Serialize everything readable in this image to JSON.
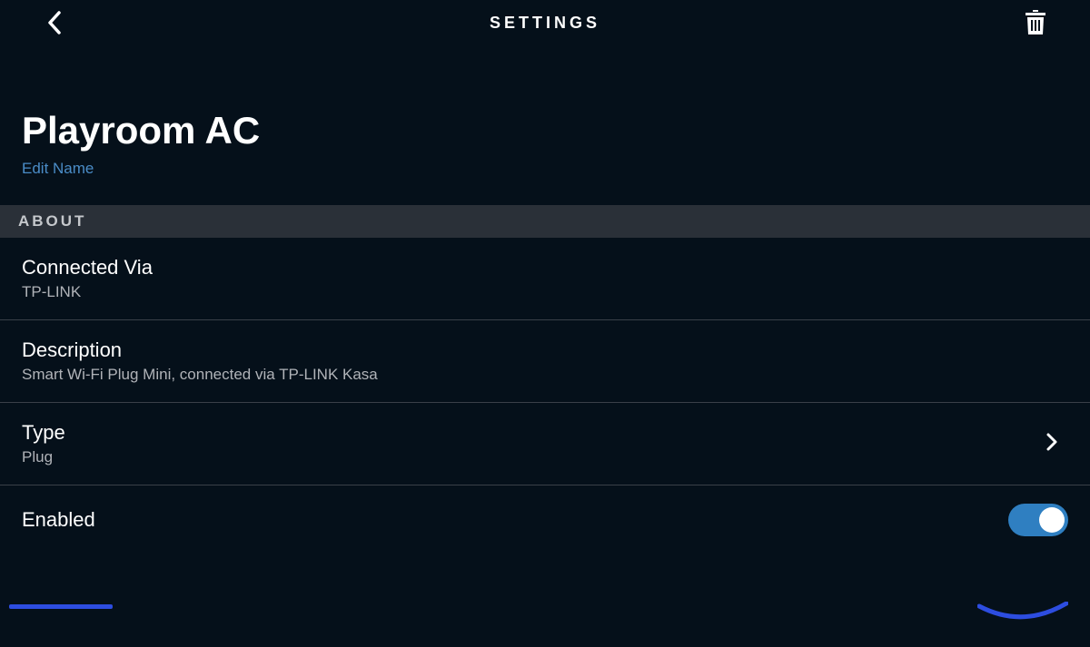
{
  "header": {
    "title": "SETTINGS"
  },
  "device": {
    "name": "Playroom AC",
    "edit_name_label": "Edit Name"
  },
  "about": {
    "section_label": "ABOUT",
    "items": [
      {
        "title": "Connected Via",
        "subtitle": "TP-LINK"
      },
      {
        "title": "Description",
        "subtitle": "Smart Wi-Fi Plug Mini, connected via TP-LINK Kasa"
      },
      {
        "title": "Type",
        "subtitle": "Plug"
      }
    ]
  },
  "enabled": {
    "label": "Enabled",
    "value": true
  }
}
